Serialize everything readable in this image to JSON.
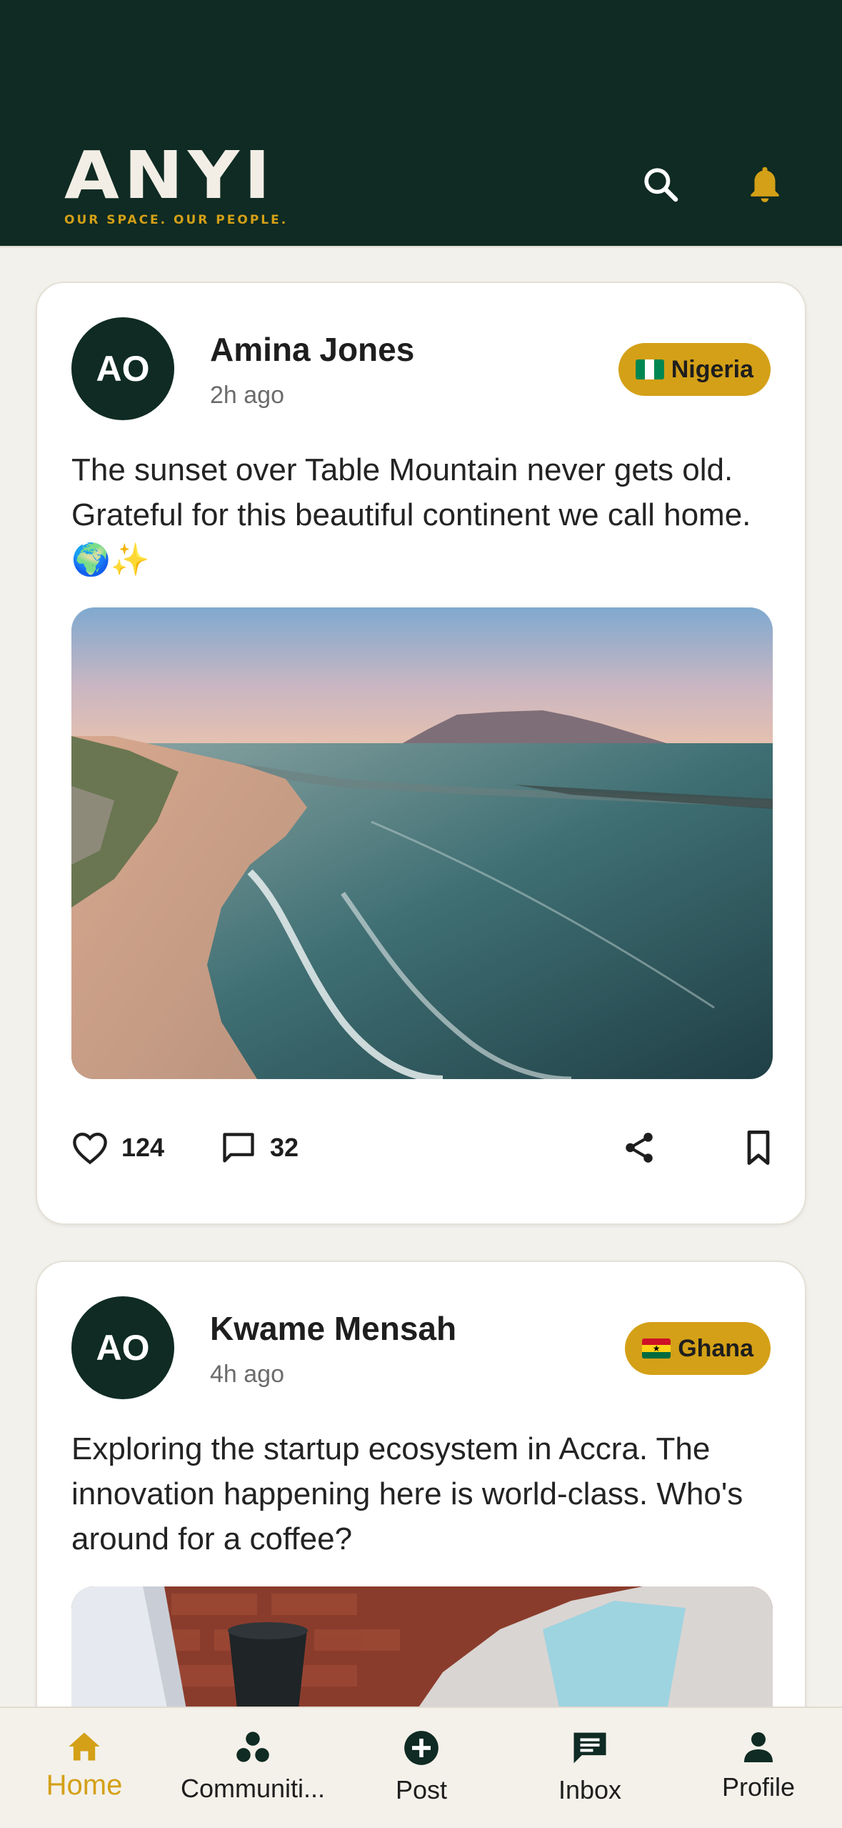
{
  "app": {
    "logo_word": "ANYI",
    "logo_tagline": "OUR SPACE. OUR PEOPLE."
  },
  "header": {
    "icons": [
      "search-icon",
      "bell-icon"
    ]
  },
  "posts": [
    {
      "initials": "AO",
      "author": "Amina Jones",
      "time": "2h ago",
      "country": "Nigeria",
      "flag": "nigeria-flag",
      "text": "The sunset over Table Mountain never gets old. Grateful for this beautiful continent we call home. 🌍✨",
      "likes": "124",
      "comments": "32"
    },
    {
      "initials": "AO",
      "author": "Kwame Mensah",
      "time": "4h ago",
      "country": "Ghana",
      "flag": "ghana-flag",
      "text": "Exploring the startup ecosystem in Accra. The innovation happening here is world-class. Who's around for a coffee?"
    }
  ],
  "nav": {
    "items": [
      {
        "label": "Home",
        "icon": "home-icon",
        "active": true
      },
      {
        "label": "Communiti...",
        "icon": "communities-icon",
        "active": false
      },
      {
        "label": "Post",
        "icon": "add-circle-icon",
        "active": false
      },
      {
        "label": "Inbox",
        "icon": "message-icon",
        "active": false
      },
      {
        "label": "Profile",
        "icon": "person-icon",
        "active": false
      }
    ]
  },
  "colors": {
    "header_bg": "#0F2B23",
    "accent_gold": "#D4A017",
    "page_bg": "#F3F1EC",
    "card_bg": "#FFFFFF"
  }
}
